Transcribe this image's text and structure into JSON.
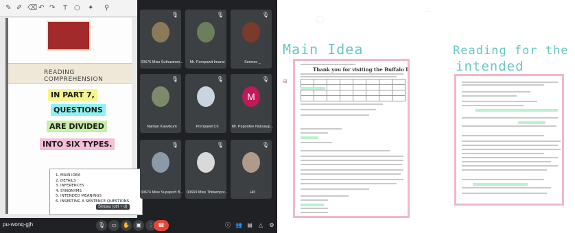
{
  "meeting": {
    "code": "pu-wonq-gjh",
    "tooltip": "Sindau (ctrl + d)"
  },
  "slide": {
    "band_title": "READING COMPREHENSION",
    "highlight_lines": [
      "IN PART 7,",
      "QUESTIONS",
      "ARE DIVIDED",
      "INTO SIX TYPES."
    ],
    "list_items": [
      "1. MAIN IDEA",
      "2. DETAILS",
      "3. INFERENCES",
      "4. SYNONYMS",
      "5. INTENDED MEANINGS",
      "6. INSERTING A SENTENCE QUESTIONS"
    ],
    "colors": {
      "yellow": "#f5f589",
      "cyan": "#8ff2f2",
      "green": "#c7efa8",
      "pink": "#f6bfd9"
    }
  },
  "participants": [
    {
      "name": "00676 Miss Suthasinee...",
      "avatar_color": "#8b7a5a"
    },
    {
      "name": "Mr. Pornpawit Imarat",
      "avatar_color": "#6a7f5a"
    },
    {
      "name": "Sermee _",
      "avatar_color": "#7a3b2a"
    },
    {
      "name": "Nantan Kaewkum",
      "avatar_color": "#7c8a6a"
    },
    {
      "name": "Pornpawit Ch",
      "avatar_color": "#c9d4e0"
    },
    {
      "name": "Mr. Papontee Nuksaup...",
      "avatar_color": "#c2185b",
      "initial": "M"
    },
    {
      "name": "00674 Miss Supapich B...",
      "avatar_color": "#8a9aa8"
    },
    {
      "name": "00669 Miss Thitiampor...",
      "avatar_color": "#d9d9d9"
    },
    {
      "name": "Hill",
      "avatar_color": "#b09a8a"
    }
  ],
  "notes": {
    "main_idea_title": "Main Idea",
    "reading_title_line1": "Reading for the",
    "reading_title_line2": "intended Meaning",
    "doc1_heading": "Thank you for visiting the Buffalo Inn."
  }
}
